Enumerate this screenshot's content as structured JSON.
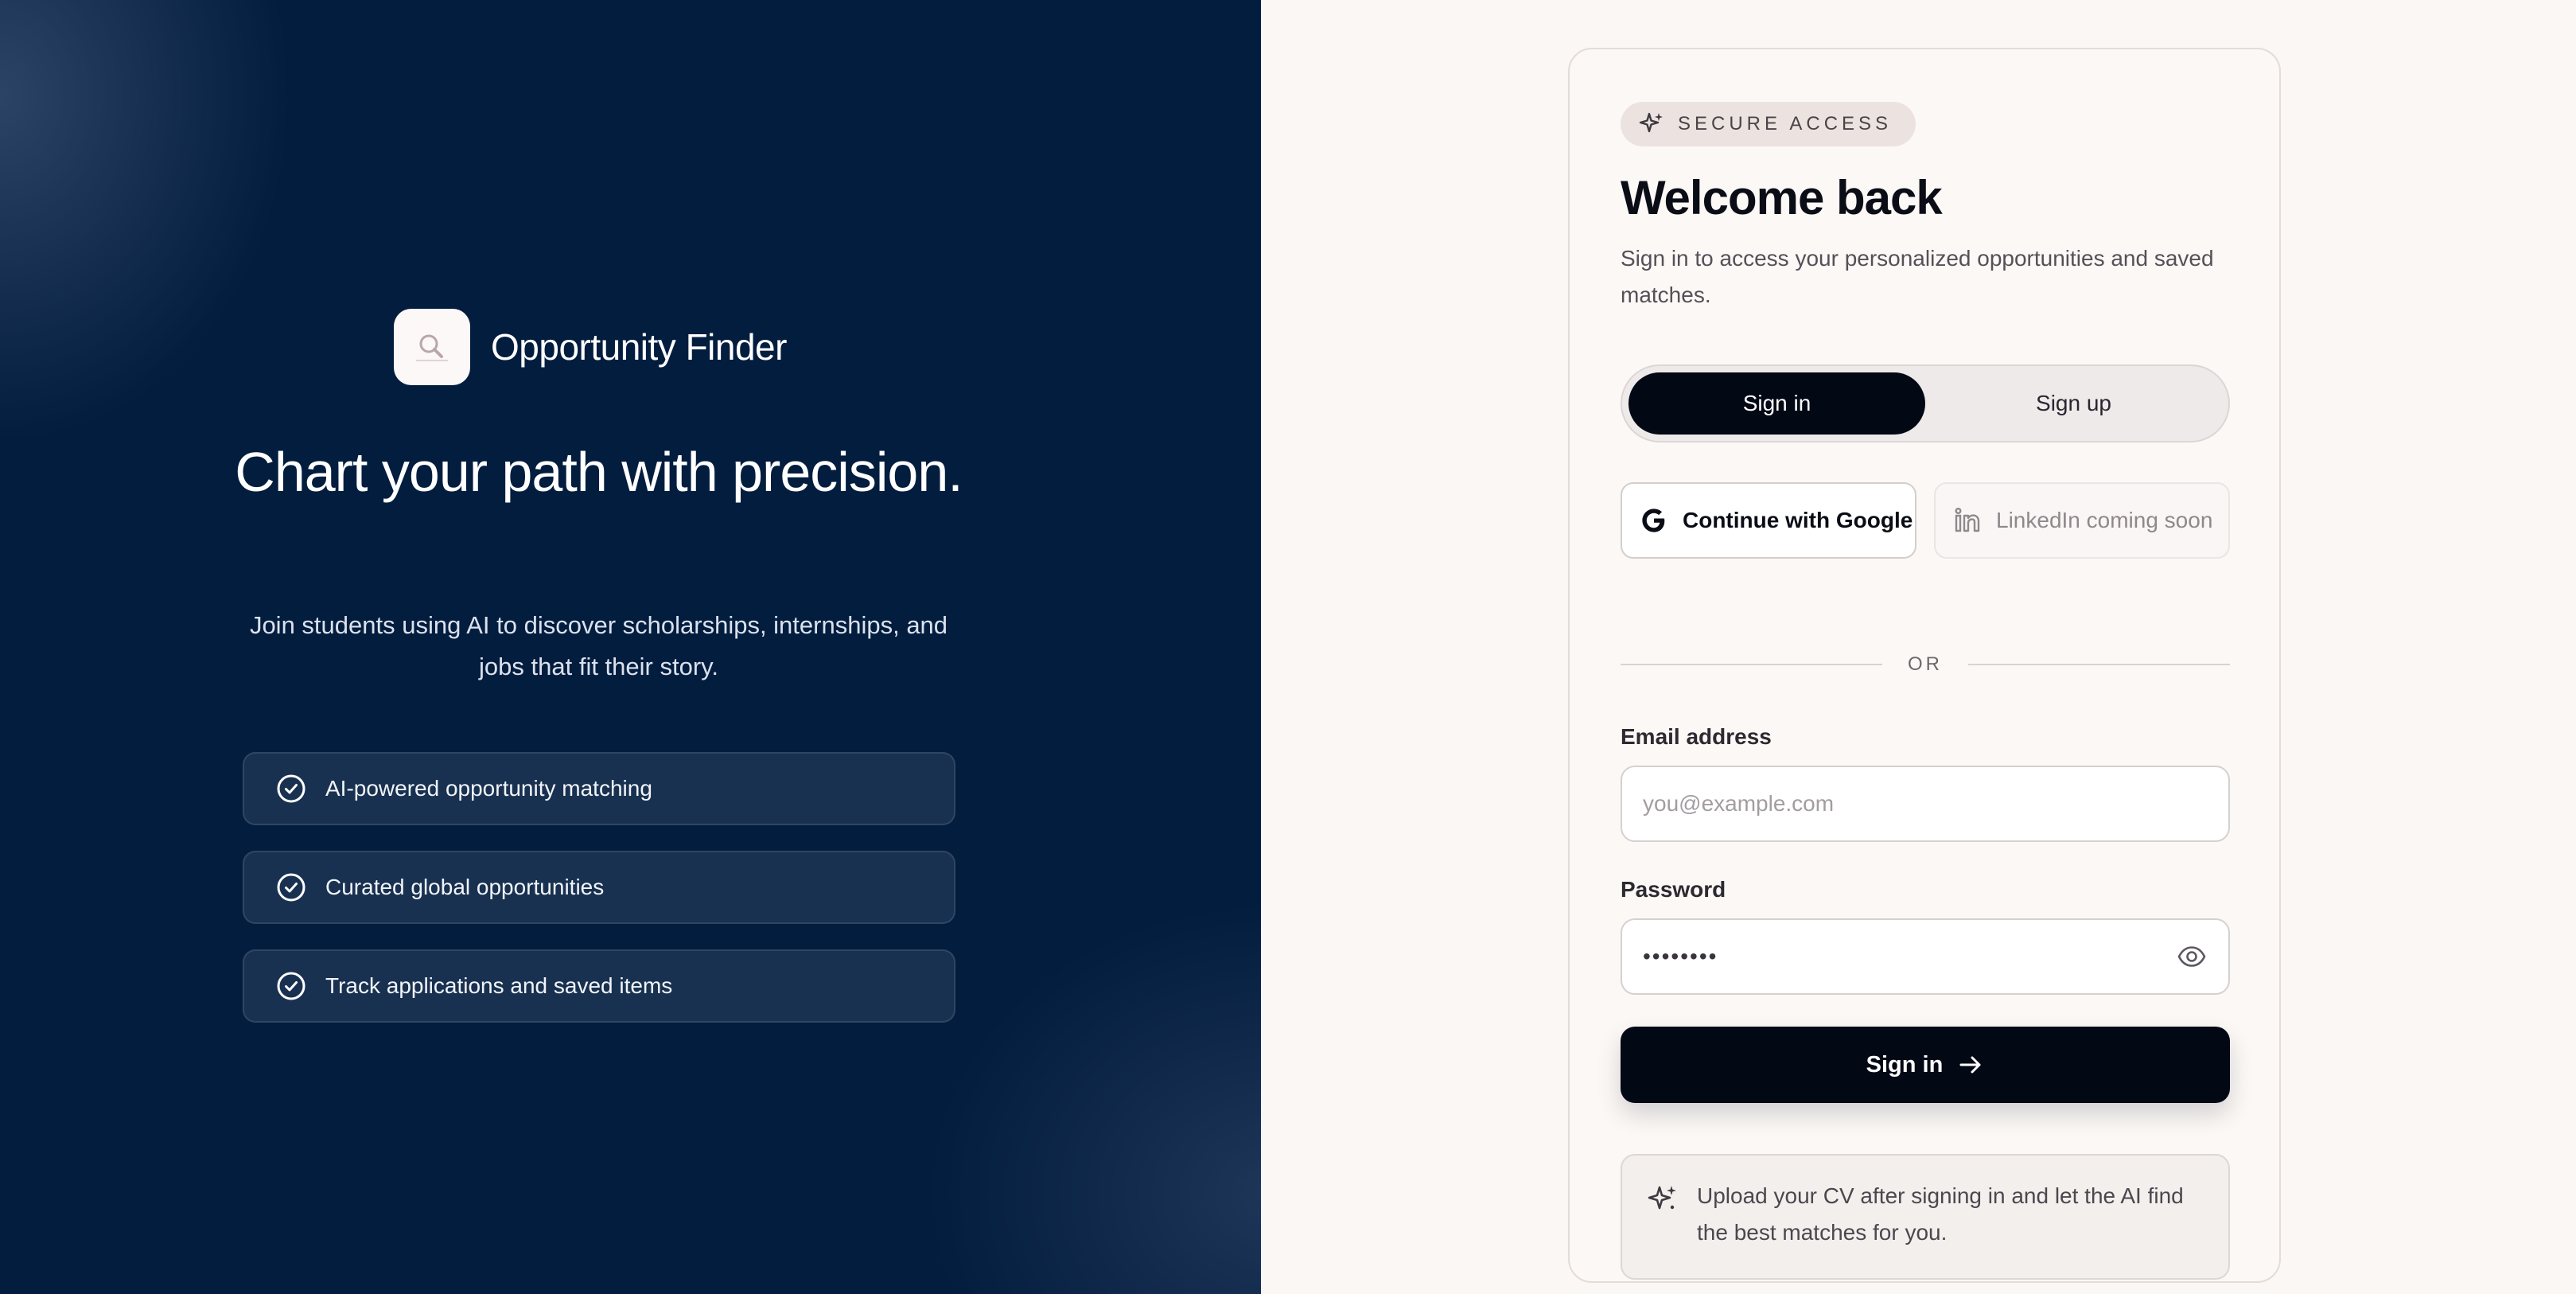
{
  "brand": {
    "name": "Opportunity Finder",
    "logo_icon": "magnifier-logo-icon"
  },
  "hero": {
    "headline": "Chart your path with precision.",
    "subtitle": "Join students using AI to discover scholarships, internships, and jobs that fit their story."
  },
  "features": [
    {
      "label": "AI-powered opportunity matching",
      "icon": "check-circle-icon"
    },
    {
      "label": "Curated global opportunities",
      "icon": "check-circle-icon"
    },
    {
      "label": "Track applications and saved items",
      "icon": "check-circle-icon"
    }
  ],
  "card": {
    "badge": "SECURE ACCESS",
    "title": "Welcome back",
    "description": "Sign in to access your personalized opportunities and saved matches.",
    "tabs": {
      "signin": "Sign in",
      "signup": "Sign up",
      "active": "signin"
    },
    "google_label": "Continue with Google",
    "linkedin_label": "LinkedIn coming soon",
    "divider": "OR",
    "email": {
      "label": "Email address",
      "placeholder": "you@example.com",
      "value": ""
    },
    "password": {
      "label": "Password",
      "value": "••••••••"
    },
    "submit_label": "Sign in",
    "hint": "Upload your CV after signing in and let the AI find the best matches for you."
  },
  "colors": {
    "left_bg": "#031d3f",
    "right_bg": "#faf7f5",
    "primary_button": "#030815",
    "badge_bg": "#ece3e1"
  }
}
